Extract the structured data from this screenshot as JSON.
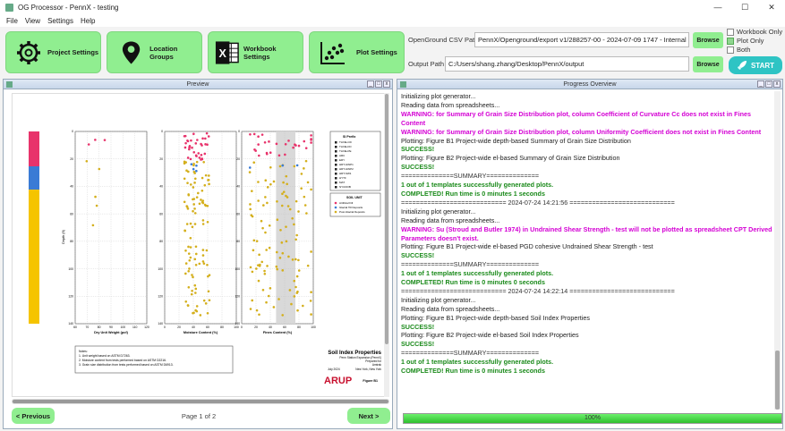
{
  "window": {
    "title": "OG Processor - PennX - testing",
    "controls": [
      "—",
      "☐",
      "✕"
    ]
  },
  "menu": [
    "File",
    "View",
    "Settings",
    "Help"
  ],
  "toolbar": {
    "project_settings": "Project Settings",
    "location_groups": "Location Groups",
    "workbook_settings": "Workbook Settings",
    "plot_settings": "Plot Settings",
    "csv_label": "OpenGround CSV Path",
    "csv_value": "PennX/Openground/export v1/288257-00 - 2024-07-09 1747 - Internal - 9",
    "output_label": "Output Path",
    "output_value": "C:/Users/shang.zhang/Desktop/PennX/output",
    "browse": "Browse",
    "workbook_only": "Workbook Only",
    "plot_only": "Plot Only",
    "both": "Both",
    "plot_only_checked": true,
    "start": "START"
  },
  "preview": {
    "title": "Preview",
    "page_label": "Page 1 of 2",
    "prev": "< Previous",
    "next": "Next >",
    "figure": {
      "units": [
        "Artificial Fill",
        "Glacial Till Deposits",
        "Post-Glacial Deposits"
      ],
      "charts": [
        {
          "xlabel": "Dry Unit Weight (pcf)",
          "ticks": [
            "60",
            "70",
            "80",
            "90",
            "100",
            "110",
            "120"
          ]
        },
        {
          "xlabel": "Moisture Content (%)",
          "ticks": [
            "0",
            "20",
            "40",
            "60",
            "80",
            "100"
          ]
        },
        {
          "xlabel": "Fines Content (%)",
          "ticks": [
            "0",
            "20",
            "40",
            "60",
            "80",
            "100"
          ]
        }
      ],
      "depth_ticks": [
        "0",
        "20",
        "40",
        "60",
        "80",
        "100",
        "120",
        "140"
      ],
      "ylabel": "Depth (ft)",
      "legend_title": "SI Prefix",
      "legend_items": [
        "TLINE-CD",
        "TLINE-FD",
        "TLINE-PE",
        "ARC",
        "ERY",
        "HRT-GWP1",
        "HRT-GWP2",
        "HRT-SW1",
        "HYTF",
        "MAT",
        "NYCDOB"
      ],
      "soil_unit_title": "SOIL UNIT",
      "notes": [
        "Notes:",
        "1. Unit weight based on ASTM D7263.",
        "2. Moisture content from tests performed based on ASTM D2216.",
        "3. Grain size distribution from tests performed based on ASTM D6913."
      ],
      "sheet_title": "Soil Index Properties",
      "sheet_sub": "Penn Station Expansion (PennX)",
      "sheet_line3": "Prepared for",
      "sheet_line4": "Amtrak",
      "sheet_date": "July 2024",
      "sheet_loc": "New York, New York",
      "brand": "ARUP",
      "fig_no": "Figure B1"
    }
  },
  "progress": {
    "title": "Progress Overview",
    "percent": "100%",
    "fraction": 1.0,
    "log": [
      {
        "t": "info",
        "s": "Initializing plot generator..."
      },
      {
        "t": "info",
        "s": "Reading data from spreadsheets..."
      },
      {
        "t": "warn",
        "s": "WARNING: for Summary of Grain Size Distribution plot, column Coefficient of Curvature Cc does not exist in Fines Content"
      },
      {
        "t": "warn",
        "s": "WARNING: for Summary of Grain Size Distribution plot, column Uniformity Coefficient does not exist in Fines Content"
      },
      {
        "t": "info",
        "s": "Plotting: Figure B1 Project-wide depth-based Summary of Grain Size Distribution"
      },
      {
        "t": "ok",
        "s": "SUCCESS!"
      },
      {
        "t": "info",
        "s": "Plotting: Figure B2 Project-wide el-based Summary of Grain Size Distribution"
      },
      {
        "t": "ok",
        "s": "SUCCESS!"
      },
      {
        "t": "blank",
        "s": " "
      },
      {
        "t": "sep",
        "s": "==============SUMMARY=============="
      },
      {
        "t": "ok",
        "s": "1 out of 1 templates successfully generated plots."
      },
      {
        "t": "ok",
        "s": "COMPLETED! Run time is 0 minutes 1 seconds"
      },
      {
        "t": "sep",
        "s": "============================ 2024-07-24 14:21:56 ============================"
      },
      {
        "t": "info",
        "s": "Initializing plot generator..."
      },
      {
        "t": "info",
        "s": "Reading data from spreadsheets..."
      },
      {
        "t": "warn",
        "s": "WARNING: Su (Stroud and Butler 1974) in Undrained Shear Strength - test will not be plotted as spreadsheet CPT Derived Parameters doesn't exist."
      },
      {
        "t": "info",
        "s": "Plotting: Figure B1 Project-wide el-based PGD cohesive Undrained Shear Strength - test"
      },
      {
        "t": "ok",
        "s": "SUCCESS!"
      },
      {
        "t": "blank",
        "s": " "
      },
      {
        "t": "sep",
        "s": "==============SUMMARY=============="
      },
      {
        "t": "ok",
        "s": "1 out of 1 templates successfully generated plots."
      },
      {
        "t": "ok",
        "s": "COMPLETED! Run time is 0 minutes 0 seconds"
      },
      {
        "t": "sep",
        "s": "============================ 2024-07-24 14:22:14 ============================"
      },
      {
        "t": "info",
        "s": "Initializing plot generator..."
      },
      {
        "t": "info",
        "s": "Reading data from spreadsheets..."
      },
      {
        "t": "info",
        "s": "Plotting: Figure B1 Project-wide depth-based Soil Index Properties"
      },
      {
        "t": "ok",
        "s": "SUCCESS!"
      },
      {
        "t": "info",
        "s": "Plotting: Figure B2 Project-wide el-based Soil Index Properties"
      },
      {
        "t": "ok",
        "s": "SUCCESS!"
      },
      {
        "t": "blank",
        "s": " "
      },
      {
        "t": "sep",
        "s": "==============SUMMARY=============="
      },
      {
        "t": "ok",
        "s": "1 out of 1 templates successfully generated plots."
      },
      {
        "t": "ok",
        "s": "COMPLETED! Run time is 0 minutes 1 seconds"
      }
    ]
  },
  "colors": {
    "button_green": "#90ee90",
    "start": "#2ec4c4",
    "warning": "#d400d4",
    "success": "#1a8a1a"
  }
}
